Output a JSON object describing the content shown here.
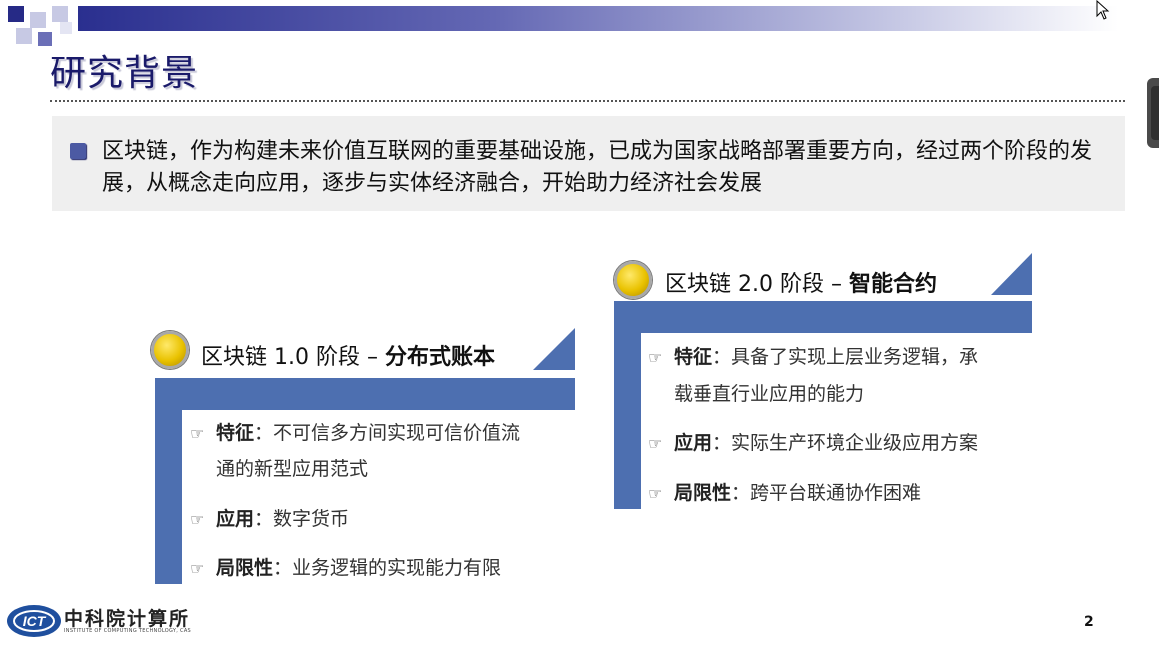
{
  "title": "研究背景",
  "intro": "区块链，作为构建未来价值互联网的重要基础设施，已成为国家战略部署重要方向，经过两个阶段的发展，从概念走向应用，逐步与实体经济融合，开始助力经济社会发展",
  "stage1": {
    "title": "区块链 1.0 阶段 – ",
    "title_bold": "分布式账本",
    "items": [
      {
        "key": "特征",
        "sep": "：",
        "text": "不可信多方间实现可信价值流",
        "cont": "通的新型应用范式"
      },
      {
        "key": "应用",
        "sep": "：",
        "text": "数字货币"
      },
      {
        "key": "局限性",
        "sep": "：",
        "text": "业务逻辑的实现能力有限"
      }
    ]
  },
  "stage2": {
    "title": "区块链 2.0 阶段 – ",
    "title_bold": "智能合约",
    "items": [
      {
        "key": "特征",
        "sep": "：",
        "text": "具备了实现上层业务逻辑，承",
        "cont": "载垂直行业应用的能力"
      },
      {
        "key": "应用",
        "sep": "：",
        "text": "实际生产环境企业级应用方案"
      },
      {
        "key": "局限性",
        "sep": "：",
        "text": "跨平台联通协作困难"
      }
    ]
  },
  "logo": {
    "abbr": "ICT",
    "name": "中科院计算所",
    "subtitle": "INSTITUTE OF COMPUTING TECHNOLOGY, CAS"
  },
  "page_number": "2",
  "colors": {
    "accent_blue": "#4d6fb0",
    "title_navy": "#1a1a6a",
    "bullet_gold": "#e9c200"
  },
  "icons": {
    "bullet": "hand-pointer-icon",
    "stage_marker": "gold-circle-icon",
    "cursor": "mouse-cursor-icon"
  }
}
